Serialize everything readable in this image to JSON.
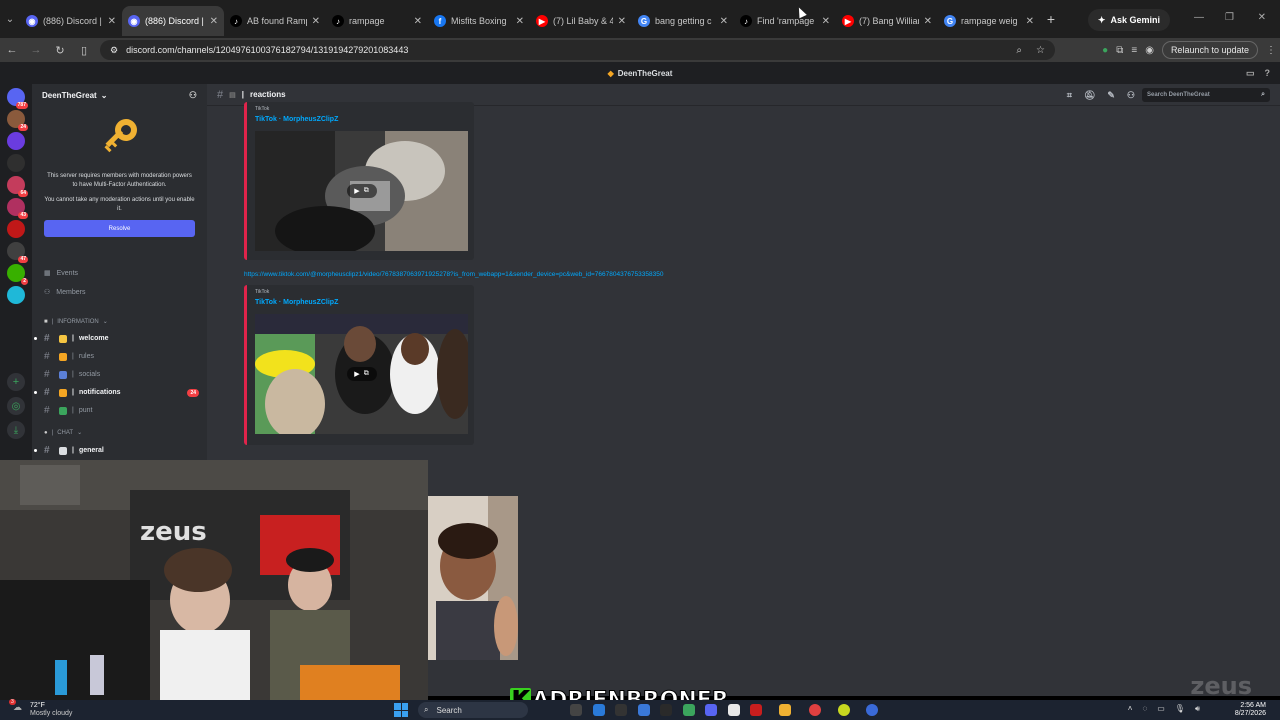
{
  "browser": {
    "tabs": [
      {
        "title": "(886) Discord |",
        "icon": "discord-icon",
        "color": "#5865f2"
      },
      {
        "title": "(886) Discord |",
        "icon": "discord-icon",
        "color": "#5865f2",
        "active": true
      },
      {
        "title": "AB found Ramp",
        "icon": "tiktok-icon",
        "color": "#000000"
      },
      {
        "title": "rampage",
        "icon": "tiktok-icon",
        "color": "#000000"
      },
      {
        "title": "Misfits Boxing",
        "icon": "facebook-icon",
        "color": "#1877f2"
      },
      {
        "title": "(7) Lil Baby & 4",
        "icon": "youtube-icon",
        "color": "#ff0000"
      },
      {
        "title": "bang getting c",
        "icon": "google-icon",
        "color": "#4285f4"
      },
      {
        "title": "Find 'rampage",
        "icon": "tiktok-icon",
        "color": "#000000"
      },
      {
        "title": "(7) Bang Willian",
        "icon": "youtube-icon",
        "color": "#ff0000"
      },
      {
        "title": "rampage weig",
        "icon": "google-icon",
        "color": "#4285f4"
      }
    ],
    "ask_gemini": "Ask Gemini",
    "url": "discord.com/channels/1204976100376182794/1319194279201083443",
    "relaunch": "Relaunch to update"
  },
  "discord": {
    "window_title": "DeenTheGreat",
    "server_name": "DeenTheGreat",
    "mfa_notice": {
      "line1": "This server requires members with moderation powers to have Multi-Factor Authentication.",
      "line2": "You cannot take any moderation actions until you enable it.",
      "button": "Resolve"
    },
    "nav": {
      "events": "Events",
      "members": "Members"
    },
    "categories": {
      "information": "INFORMATION",
      "chat": "CHAT"
    },
    "channels": [
      {
        "name": "welcome",
        "bright": true,
        "emoji_color": "#f5c542"
      },
      {
        "name": "rules",
        "bright": false,
        "emoji_color": "#f5a623"
      },
      {
        "name": "socials",
        "bright": false,
        "emoji_color": "#5b7fd6"
      },
      {
        "name": "notifications",
        "bright": true,
        "emoji_color": "#f5a623",
        "badge": "24"
      },
      {
        "name": "punt",
        "bright": false,
        "emoji_color": "#3ba55d"
      },
      {
        "name": "general",
        "bright": true,
        "emoji_color": "#dbdee1"
      }
    ],
    "servers": [
      {
        "badge": "787",
        "color": "#5865f2"
      },
      {
        "badge": "24",
        "color": "#8a5a3c"
      },
      {
        "badge": "",
        "color": "#6a3ce0"
      },
      {
        "badge": "",
        "color": "#2f2f2f"
      },
      {
        "badge": "64",
        "color": "#c43c5c"
      },
      {
        "badge": "43",
        "color": "#b03060"
      },
      {
        "badge": "",
        "color": "#c01818"
      },
      {
        "badge": "47",
        "color": "#404040"
      },
      {
        "badge": "2",
        "color": "#38b000"
      },
      {
        "badge": "",
        "color": "#1fb8d8"
      }
    ],
    "channel_header": {
      "name": "reactions",
      "search_placeholder": "Search DeenTheGreat"
    },
    "embeds": [
      {
        "provider": "TikTok",
        "author": "TikTok · MorpheusZClipZ"
      },
      {
        "provider": "TikTok",
        "author": "TikTok · MorpheusZClipZ"
      }
    ],
    "link": "https://www.tiktok.com/@morpheusclipz1/video/7678387063971925278?is_from_webapp=1&sender_device=pc&web_id=7667804376753358350"
  },
  "stream_overlay": {
    "name_first": "K",
    "name_rest": "ADRIENBRONER",
    "watermark": "zeus"
  },
  "taskbar": {
    "weather_temp": "72°F",
    "weather_desc": "Mostly cloudy",
    "weather_badge": "3",
    "search": "Search",
    "time": "2:56 AM",
    "date": "8/27/2026"
  }
}
